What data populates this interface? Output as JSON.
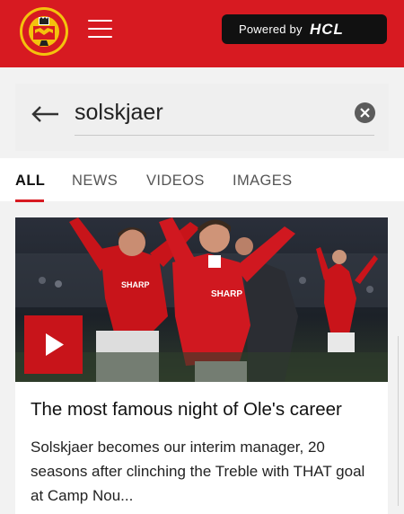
{
  "header": {
    "crest_text": "MANCHESTER UNITED",
    "powered_by_label": "Powered by",
    "sponsor_name": "HCL",
    "color": "#d71a21"
  },
  "search": {
    "query": "solskjaer",
    "back_icon": "arrow-left-icon",
    "clear_icon": "close-circle-icon"
  },
  "tabs": [
    {
      "label": "ALL",
      "active": true
    },
    {
      "label": "NEWS",
      "active": false
    },
    {
      "label": "VIDEOS",
      "active": false
    },
    {
      "label": "IMAGES",
      "active": false
    }
  ],
  "results": [
    {
      "kind": "video",
      "title": "The most famous night of Ole's career",
      "description": "Solskjaer becomes our interim manager, 20 seasons after clinching the Treble with THAT goal at Camp Nou...",
      "shirt_text": "SHARP",
      "play_icon": "play-icon"
    }
  ]
}
